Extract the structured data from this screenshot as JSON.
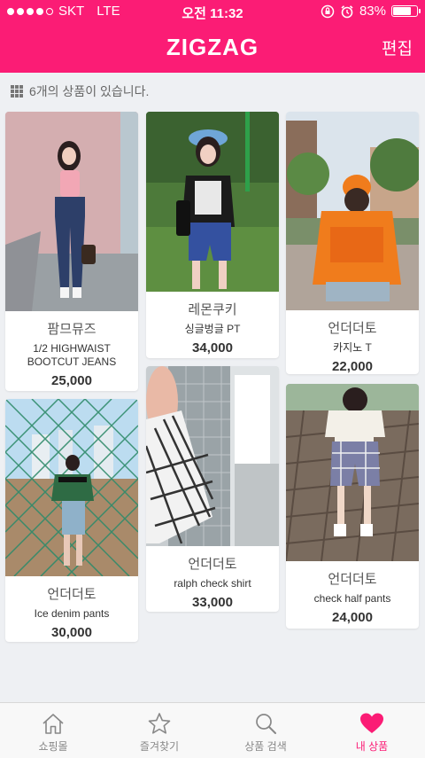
{
  "status": {
    "carrier": "SKT",
    "network": "LTE",
    "time": "오전 11:32",
    "battery": "83%",
    "battery_level": 0.83
  },
  "header": {
    "title": "ZIGZAG",
    "edit_label": "편집",
    "accent": "#fb1c75"
  },
  "count_text": "6개의 상품이 있습니다.",
  "products": [
    {
      "shop": "팜므뮤즈",
      "name_lines": [
        "1/2 HIGHWAIST",
        "BOOTCUT JEANS"
      ],
      "price": "25,000"
    },
    {
      "shop": "레몬쿠키",
      "name_lines": [
        "싱글벙글 PT"
      ],
      "price": "34,000"
    },
    {
      "shop": "언더더토",
      "name_lines": [
        "카지노 T"
      ],
      "price": "22,000"
    },
    {
      "shop": "언더더토",
      "name_lines": [
        "Ice denim pants"
      ],
      "price": "30,000"
    },
    {
      "shop": "언더더토",
      "name_lines": [
        "ralph check shirt"
      ],
      "price": "33,000"
    },
    {
      "shop": "언더더토",
      "name_lines": [
        "check half pants"
      ],
      "price": "24,000"
    }
  ],
  "tabs": [
    {
      "label": "쇼핑몰",
      "icon": "home-icon"
    },
    {
      "label": "즐겨찾기",
      "icon": "star-icon"
    },
    {
      "label": "상품 검색",
      "icon": "search-icon"
    },
    {
      "label": "내 상품",
      "icon": "heart-icon",
      "active": true
    }
  ]
}
